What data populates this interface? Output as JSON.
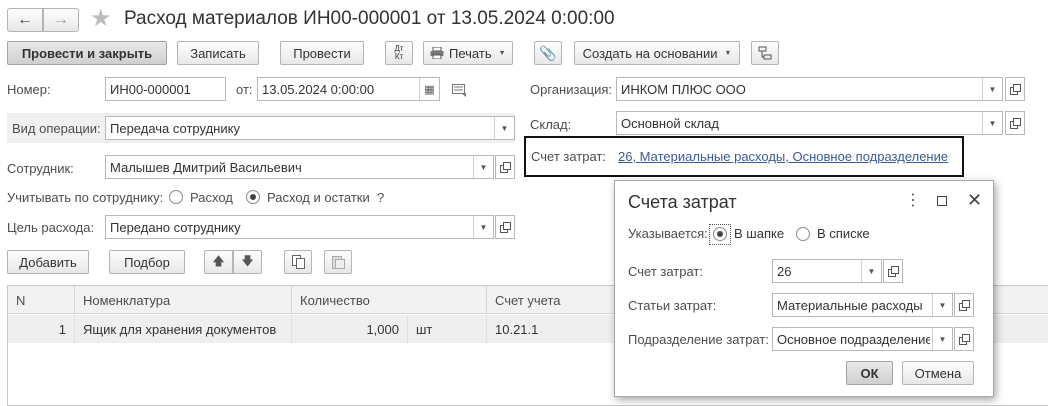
{
  "title": "Расход материалов ИН00-000001 от 13.05.2024 0:00:00",
  "toolbar": {
    "post_close": "Провести и закрыть",
    "save": "Записать",
    "post": "Провести",
    "dt_kt_top": "Дт",
    "dt_kt_bottom": "Кт",
    "print": "Печать",
    "create_based": "Создать на основании"
  },
  "form": {
    "number_label": "Номер:",
    "number_value": "ИН00-000001",
    "from_label": "от:",
    "date_value": "13.05.2024  0:00:00",
    "org_label": "Организация:",
    "org_value": "ИНКОМ ПЛЮС ООО",
    "op_label": "Вид операции:",
    "op_value": "Передача сотруднику",
    "warehouse_label": "Склад:",
    "warehouse_value": "Основной склад",
    "cost_account_label": "Счет затрат:",
    "cost_account_value": "26, Материальные расходы, Основное подразделение",
    "employee_label": "Сотрудник:",
    "employee_value": "Малышев Дмитрий Васильевич",
    "track_label": "Учитывать по сотруднику:",
    "track_option_1": "Расход",
    "track_option_2": "Расход и остатки",
    "help": "?",
    "purpose_label": "Цель расхода:",
    "purpose_value": "Передано сотруднику"
  },
  "table_toolbar": {
    "add": "Добавить",
    "select": "Подбор"
  },
  "table": {
    "headers": [
      "N",
      "Номенклатура",
      "Количество",
      "Счет учета"
    ],
    "rows": [
      {
        "n": "1",
        "item": "Ящик для хранения документов",
        "qty": "1,000",
        "unit": "шт",
        "account": "10.21.1"
      }
    ]
  },
  "dialog": {
    "title": "Счета затрат",
    "specified_label": "Указывается:",
    "opt_header": "В шапке",
    "opt_list": "В списке",
    "account_label": "Счет затрат:",
    "account_value": "26",
    "items_label": "Статьи затрат:",
    "items_value": "Материальные расходы",
    "division_label": "Подразделение затрат:",
    "division_value": "Основное подразделение",
    "ok": "ОК",
    "cancel": "Отмена"
  }
}
